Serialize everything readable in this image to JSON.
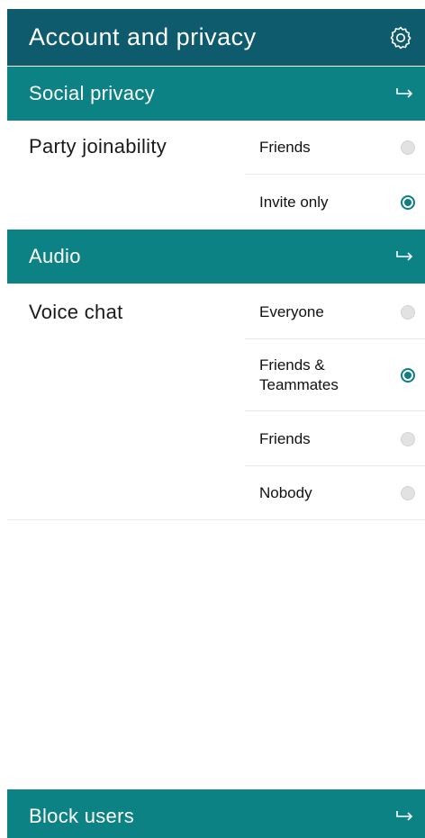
{
  "header": {
    "title": "Account and privacy",
    "icon": "gear-icon"
  },
  "sections": {
    "social": {
      "label": "Social privacy",
      "setting": "Party joinability",
      "options": [
        {
          "label": "Friends",
          "selected": false
        },
        {
          "label": "Invite only",
          "selected": true
        }
      ]
    },
    "audio": {
      "label": "Audio",
      "setting": "Voice chat",
      "options": [
        {
          "label": "Everyone",
          "selected": false
        },
        {
          "label": "Friends & Teammates",
          "selected": true
        },
        {
          "label": "Friends",
          "selected": false
        },
        {
          "label": "Nobody",
          "selected": false
        }
      ]
    },
    "block": {
      "label": "Block users"
    }
  },
  "colors": {
    "header_bg": "#0f5b6e",
    "section_bg": "#0d8285",
    "radio_selected": "#0d7f80",
    "radio_unselected": "#e2e2e2"
  }
}
